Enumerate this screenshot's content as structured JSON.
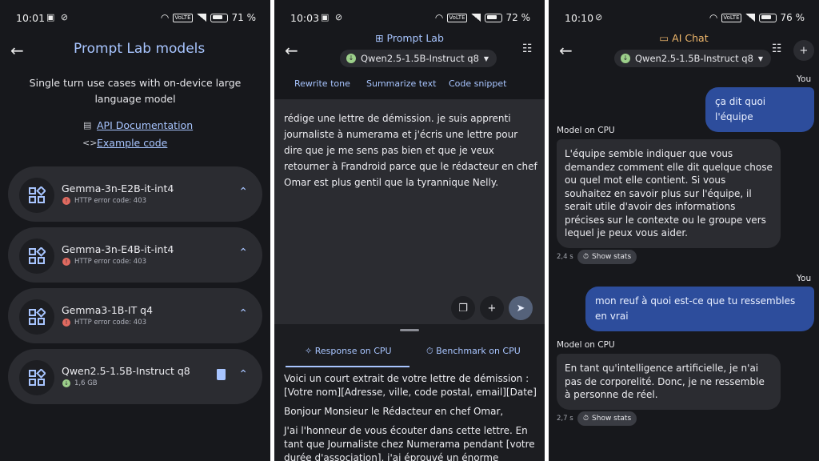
{
  "panel1": {
    "status": {
      "time": "10:01",
      "battery": "71 %"
    },
    "title": "Prompt Lab models",
    "description": "Single turn use cases with on-device large language model",
    "api_link": "API Documentation",
    "code_link": "Example code",
    "models": [
      {
        "name": "Gemma-3n-E2B-it-int4",
        "status": "HTTP error code: 403"
      },
      {
        "name": "Gemma-3n-E4B-it-int4",
        "status": "HTTP error code: 403"
      },
      {
        "name": "Gemma3-1B-IT q4",
        "status": "HTTP error code: 403"
      },
      {
        "name": "Qwen2.5-1.5B-Instruct q8",
        "status": "1,6 GB"
      }
    ]
  },
  "panel2": {
    "status": {
      "time": "10:03",
      "battery": "72 %"
    },
    "header": "Prompt Lab",
    "model": "Qwen2.5-1.5B-Instruct q8",
    "tabs": [
      "Rewrite tone",
      "Summarize text",
      "Code snippet"
    ],
    "prompt": "rédige une lettre de démission. je suis apprenti journaliste à numerama et j'écris une lettre pour dire que je me sens pas bien et que je veux retourner à Frandroid parce que le rédacteur en chef Omar est plus gentil que la tyrannique Nelly.",
    "response_tab": "Response on CPU",
    "benchmark_tab": "Benchmark on CPU",
    "response": [
      "Voici un court extrait de votre lettre de démission : [Votre nom][Adresse, ville, code postal, email][Date]",
      "Bonjour Monsieur le Rédacteur en chef Omar,",
      "J'ai l'honneur de vous écouter dans cette lettre. En tant que Journaliste chez Numerama pendant [votre durée d'association], j'ai éprouvé un énorme"
    ]
  },
  "panel3": {
    "status": {
      "time": "10:10",
      "battery": "76 %"
    },
    "header": "AI Chat",
    "model": "Qwen2.5-1.5B-Instruct q8",
    "you_label": "You",
    "model_label": "Model on CPU",
    "show_stats": "Show stats",
    "messages": {
      "user1": "ça dit quoi l'équipe",
      "model1": "L'équipe semble indiquer que vous demandez comment elle dit quelque chose ou quel mot elle contient. Si vous souhaitez en savoir plus sur l'équipe, il serait utile d'avoir des informations précises sur le contexte ou le groupe vers lequel je peux vous aider.",
      "time1": "2,4 s",
      "user2": "mon reuf à quoi est-ce que tu ressembles en vrai",
      "model2": "En tant qu'intelligence artificielle, je n'ai pas de corporelité. Donc, je ne ressemble à personne de réel.",
      "time2": "2,7 s"
    }
  }
}
